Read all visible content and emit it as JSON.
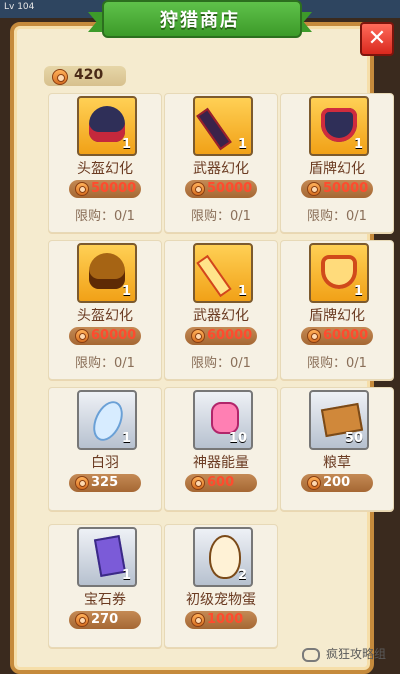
{
  "topbar": {
    "level_text": "Lv 104",
    "right_hint": ""
  },
  "header": {
    "title": "狩猎商店"
  },
  "currency": {
    "amount": "420"
  },
  "items": [
    {
      "name": "头盔幻化",
      "price": "50000",
      "quantity": "1",
      "limit": "限购：0/1",
      "affordable": false,
      "icon": "helmet-icon"
    },
    {
      "name": "武器幻化",
      "price": "50000",
      "quantity": "1",
      "limit": "限购：0/1",
      "affordable": false,
      "icon": "sword-icon"
    },
    {
      "name": "盾牌幻化",
      "price": "50000",
      "quantity": "1",
      "limit": "限购：0/1",
      "affordable": false,
      "icon": "shield-icon"
    },
    {
      "name": "头盔幻化",
      "price": "60000",
      "quantity": "1",
      "limit": "限购：0/1",
      "affordable": false,
      "icon": "helmet-gold-icon"
    },
    {
      "name": "武器幻化",
      "price": "60000",
      "quantity": "1",
      "limit": "限购：0/1",
      "affordable": false,
      "icon": "sword-gold-icon"
    },
    {
      "name": "盾牌幻化",
      "price": "60000",
      "quantity": "1",
      "limit": "限购：0/1",
      "affordable": false,
      "icon": "shield-gold-icon"
    },
    {
      "name": "白羽",
      "price": "325",
      "quantity": "1",
      "limit": "",
      "affordable": true,
      "icon": "feather-icon"
    },
    {
      "name": "神器能量",
      "price": "600",
      "quantity": "10",
      "limit": "",
      "affordable": false,
      "icon": "energy-icon"
    },
    {
      "name": "粮草",
      "price": "200",
      "quantity": "50",
      "limit": "",
      "affordable": true,
      "icon": "grass-icon"
    },
    {
      "name": "宝石券",
      "price": "270",
      "quantity": "1",
      "limit": "",
      "affordable": true,
      "icon": "ticket-icon"
    },
    {
      "name": "初级宠物蛋",
      "price": "1000",
      "quantity": "2",
      "limit": "",
      "affordable": false,
      "icon": "egg-icon"
    }
  ],
  "watermark": {
    "text": "疯狂攻略组"
  }
}
